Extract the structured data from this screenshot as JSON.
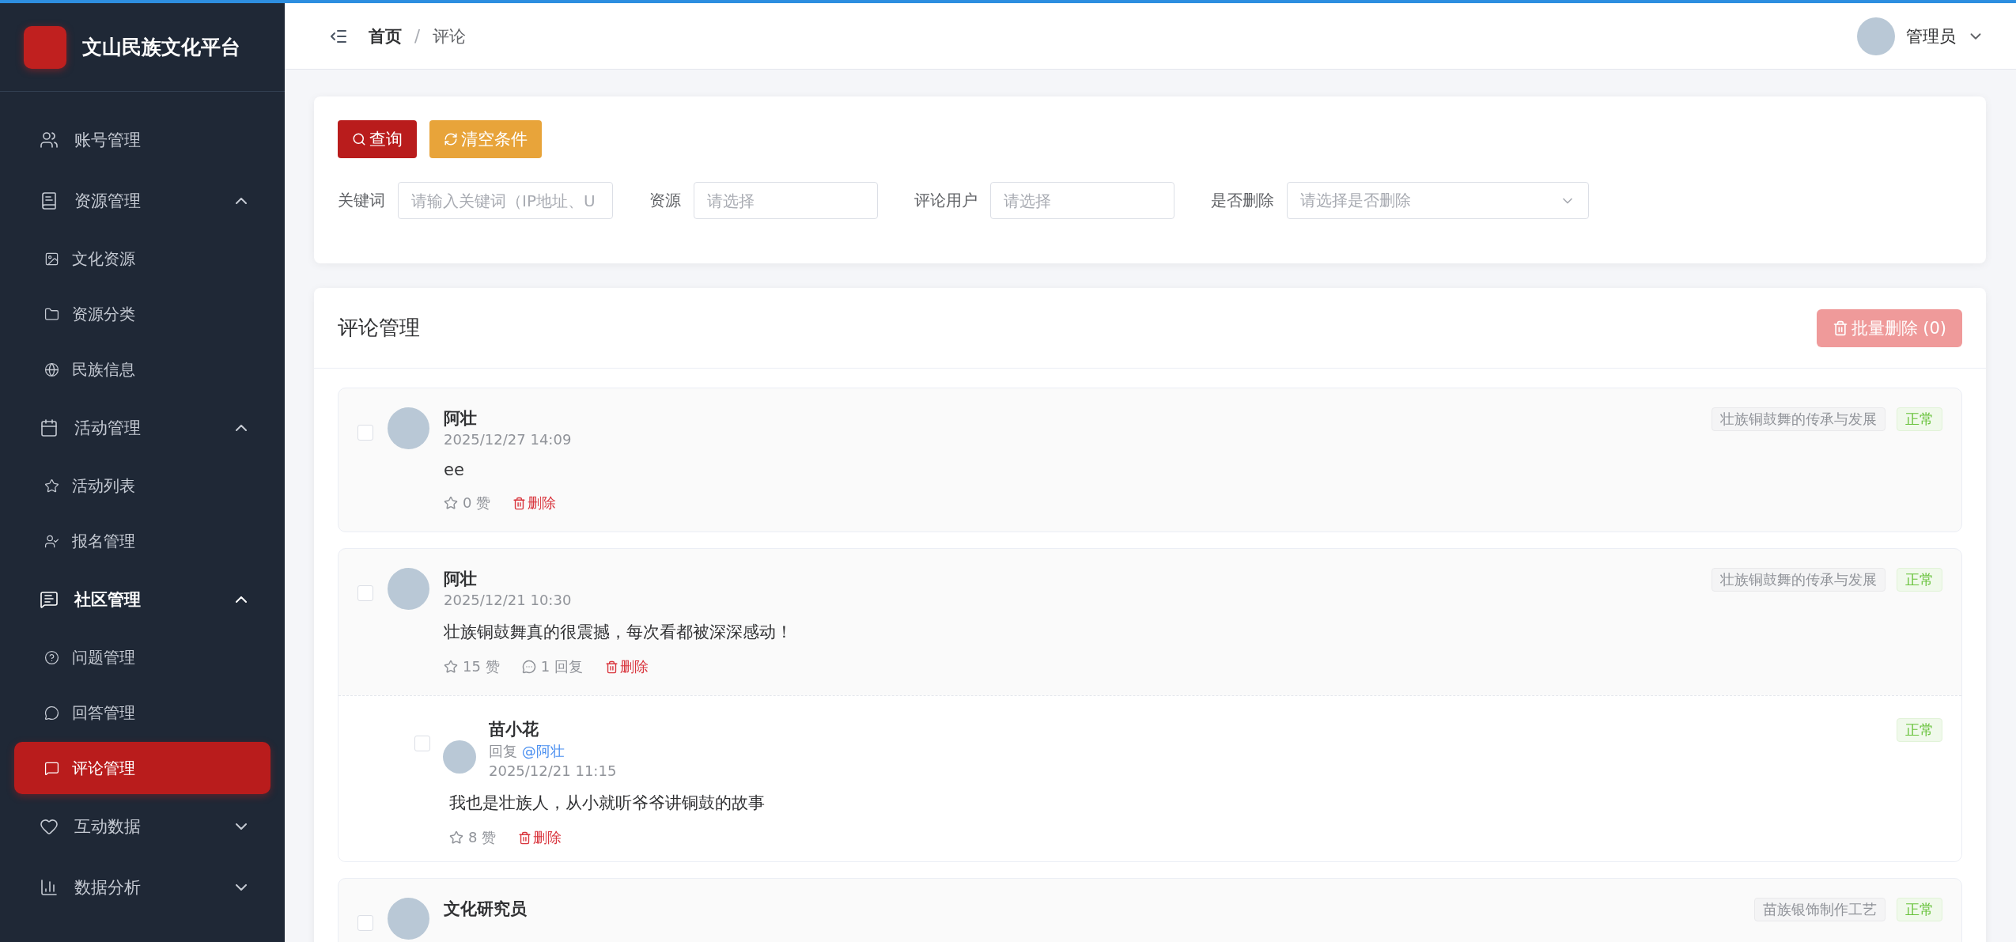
{
  "sidebar": {
    "title": "文山民族文化平台",
    "items": [
      {
        "label": "账号管理",
        "active": false
      },
      {
        "label": "资源管理",
        "active": false,
        "expanded": true,
        "children": [
          {
            "label": "文化资源",
            "selected": false
          },
          {
            "label": "资源分类",
            "selected": false
          },
          {
            "label": "民族信息",
            "selected": false
          }
        ]
      },
      {
        "label": "活动管理",
        "active": false,
        "expanded": true,
        "children": [
          {
            "label": "活动列表",
            "selected": false
          },
          {
            "label": "报名管理",
            "selected": false
          }
        ]
      },
      {
        "label": "社区管理",
        "active": true,
        "expanded": true,
        "children": [
          {
            "label": "问题管理",
            "selected": false
          },
          {
            "label": "回答管理",
            "selected": false
          },
          {
            "label": "评论管理",
            "selected": true
          }
        ]
      },
      {
        "label": "互动数据",
        "active": false,
        "expanded": false
      },
      {
        "label": "数据分析",
        "active": false,
        "expanded": false
      }
    ]
  },
  "header": {
    "breadcrumb": [
      "首页",
      "评论"
    ],
    "separator": "/",
    "user": "管理员"
  },
  "filters": {
    "buttons": [
      {
        "kind": "search",
        "label": "查询"
      },
      {
        "kind": "reset",
        "label": "清空条件"
      }
    ],
    "fields": [
      {
        "label": "关键词",
        "kind": "input",
        "placeholder": "请输入关键词（IP地址、U"
      },
      {
        "label": "资源",
        "kind": "input",
        "placeholder": "请选择"
      },
      {
        "label": "评论用户",
        "kind": "input",
        "placeholder": "请选择"
      },
      {
        "label": "是否删除",
        "kind": "select",
        "placeholder": "请选择是否删除"
      }
    ]
  },
  "comments": {
    "title": "评论管理",
    "batch_delete": {
      "label": "批量删除 (0)",
      "disabled": true
    },
    "items": [
      {
        "checked": false,
        "author": "阿壮",
        "date": "2025/12/27 14:09",
        "resource": "壮族铜鼓舞的传承与发展",
        "status": "正常",
        "content": "ee",
        "likes": "0 赞",
        "delete": "删除"
      },
      {
        "checked": false,
        "author": "阿壮",
        "date": "2025/12/21 10:30",
        "resource": "壮族铜鼓舞的传承与发展",
        "status": "正常",
        "content": "壮族铜鼓舞真的很震撼，每次看都被深深感动！",
        "likes": "15 赞",
        "reply_count": "1 回复",
        "delete": "删除",
        "replies": [
          {
            "checked": false,
            "author": "苗小花",
            "reply_prefix": "回复",
            "reply_to": "@阿壮",
            "date": "2025/12/21 11:15",
            "status": "正常",
            "content": "我也是壮族人，从小就听爷爷讲铜鼓的故事",
            "likes": "8 赞",
            "delete": "删除"
          }
        ]
      },
      {
        "checked": false,
        "author": "文化研究员",
        "resource": "苗族银饰制作工艺",
        "status": "正常"
      }
    ]
  }
}
